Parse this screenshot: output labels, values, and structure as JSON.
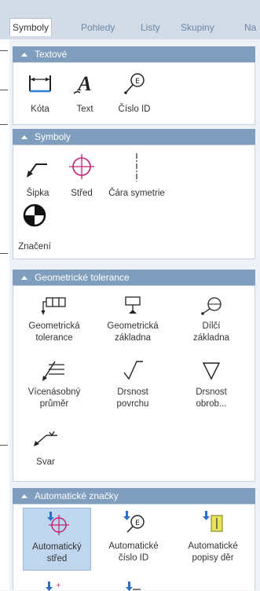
{
  "tabs": [
    "Symboly",
    "Pohledy",
    "Listy",
    "Skupiny",
    "Na"
  ],
  "groups": {
    "textove": {
      "title": "Textové",
      "items": [
        "Kóta",
        "Text",
        "Číslo ID"
      ]
    },
    "symboly": {
      "title": "Symboly",
      "items": [
        "Šipka",
        "Střed",
        "Čára symetrie",
        "Značení"
      ]
    },
    "geometricke": {
      "title": "Geometrické tolerance",
      "items": [
        [
          "Geometrická",
          "tolerance"
        ],
        [
          "Geometrická",
          "základna"
        ],
        [
          "Dílčí",
          "základna"
        ],
        [
          "Vícenásobný",
          "průměr"
        ],
        [
          "Drsnost",
          "povrchu"
        ],
        [
          "Drsnost",
          "obrob..."
        ],
        [
          "Svar"
        ]
      ]
    },
    "automaticke": {
      "title": "Automatické značky",
      "items": [
        [
          "Automatický",
          "střed"
        ],
        [
          "Automatické",
          "číslo ID"
        ],
        [
          "Automatické",
          "popisy děr"
        ]
      ]
    }
  },
  "colors": {
    "header": "#7f9dbd",
    "selected": "#bfd6ee",
    "tabs": "#d2dbe6",
    "icon_accent": "#c81e6f"
  }
}
